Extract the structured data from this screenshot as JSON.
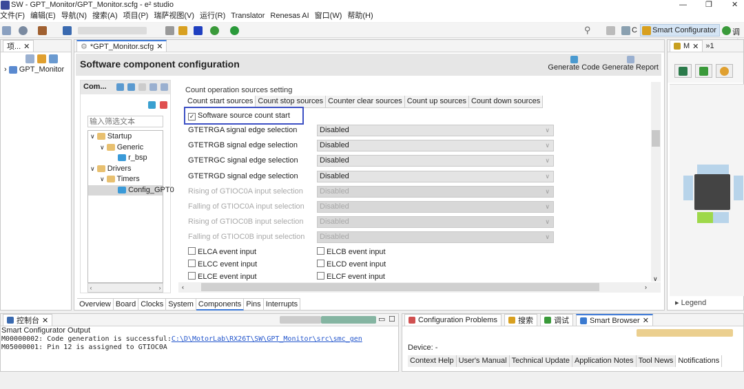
{
  "window": {
    "title": "SW - GPT_Monitor/GPT_Monitor.scfg - e² studio",
    "minimize": "—",
    "restore": "❐",
    "close": "✕"
  },
  "menu": [
    "文件(F)",
    "编辑(E)",
    "导航(N)",
    "搜索(A)",
    "项目(P)",
    "瑞萨视图(V)",
    "运行(R)",
    "Translator",
    "Renesas AI",
    "窗口(W)",
    "帮助(H)"
  ],
  "toolbar": {
    "perspectives": [
      {
        "label": "C"
      },
      {
        "label": "Smart Configurator"
      },
      {
        "label": "调试"
      }
    ]
  },
  "project_explorer": {
    "tab": "项...",
    "root": "GPT_Monitor"
  },
  "editor": {
    "tab": "*GPT_Monitor.scfg",
    "title": "Software component configuration",
    "generate_code": "Generate Code",
    "generate_report": "Generate Report",
    "components": {
      "header": "Com...",
      "filter_placeholder": "输入筛选文本",
      "tree": [
        {
          "label": "Startup",
          "level": 0
        },
        {
          "label": "Generic",
          "level": 1
        },
        {
          "label": "r_bsp",
          "level": 2
        },
        {
          "label": "Drivers",
          "level": 0
        },
        {
          "label": "Timers",
          "level": 1
        },
        {
          "label": "Config_GPT0",
          "level": 2,
          "selected": true
        }
      ]
    },
    "settings": {
      "group": "Count operation sources setting",
      "tabs": [
        "Count start sources",
        "Count stop sources",
        "Counter clear sources",
        "Count up sources",
        "Count down sources"
      ],
      "software_start": {
        "label": "Software source count start",
        "checked": true
      },
      "selects": [
        {
          "label": "GTETRGA signal edge selection",
          "value": "Disabled",
          "enabled": true
        },
        {
          "label": "GTETRGB signal edge selection",
          "value": "Disabled",
          "enabled": true
        },
        {
          "label": "GTETRGC signal edge selection",
          "value": "Disabled",
          "enabled": true
        },
        {
          "label": "GTETRGD signal edge selection",
          "value": "Disabled",
          "enabled": true
        },
        {
          "label": "Rising of GTIOC0A input selection",
          "value": "Disabled",
          "enabled": false
        },
        {
          "label": "Falling of GTIOC0A input selection",
          "value": "Disabled",
          "enabled": false
        },
        {
          "label": "Rising of GTIOC0B input selection",
          "value": "Disabled",
          "enabled": false
        },
        {
          "label": "Falling of GTIOC0B input selection",
          "value": "Disabled",
          "enabled": false
        }
      ],
      "checkboxes": [
        "ELCA event input",
        "ELCB event input",
        "ELCC event input",
        "ELCD event input",
        "ELCE event input",
        "ELCF event input"
      ]
    },
    "bottom_tabs": [
      "Overview",
      "Board",
      "Clocks",
      "System",
      "Components",
      "Pins",
      "Interrupts"
    ],
    "active_bottom_tab": "Components"
  },
  "mcu_panel": {
    "tab": "M",
    "overflow": "»1",
    "legend": "Legend"
  },
  "console": {
    "tab": "控制台",
    "title": "Smart Configurator Output",
    "line1_prefix": "M00000002: Code generation is successful:",
    "line1_link": "C:\\D\\MotorLab\\RX26T\\SW\\GPT_Monitor\\src\\smc_gen",
    "line2": "M05000001: Pin 12 is assigned to GTIOC0A"
  },
  "browser": {
    "tabs": [
      "Configuration Problems",
      "搜索",
      "调试",
      "Smart Browser"
    ],
    "device": "Device: -",
    "subtabs": [
      "Context Help",
      "User's Manual",
      "Technical Update",
      "Application Notes",
      "Tool News",
      "Notifications"
    ],
    "active_subtab": "Notifications"
  },
  "colors": {
    "accent": "#3a78d8",
    "highlight_box": "#3b4fc4",
    "link": "#2255cc"
  }
}
